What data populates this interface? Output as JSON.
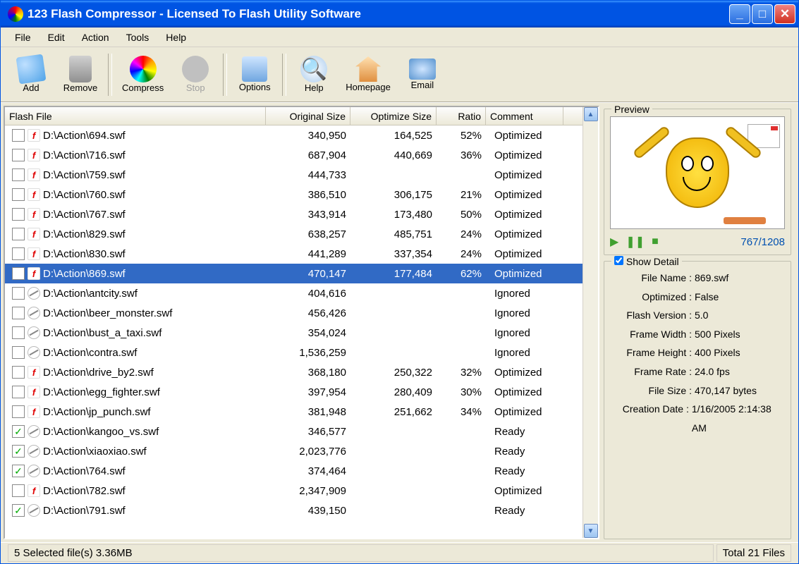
{
  "window": {
    "title": "123 Flash Compressor - Licensed To Flash Utility Software"
  },
  "menu": {
    "file": "File",
    "edit": "Edit",
    "action": "Action",
    "tools": "Tools",
    "help": "Help"
  },
  "toolbar": {
    "add": "Add",
    "remove": "Remove",
    "compress": "Compress",
    "stop": "Stop",
    "options": "Options",
    "help": "Help",
    "homepage": "Homepage",
    "email": "Email"
  },
  "columns": {
    "file": "Flash File",
    "orig": "Original Size",
    "opt": "Optimize Size",
    "ratio": "Ratio",
    "comment": "Comment"
  },
  "rows": [
    {
      "chk": false,
      "type": "flash",
      "path": "D:\\Action\\694.swf",
      "orig": "340,950",
      "opt": "164,525",
      "ratio": "52%",
      "comment": "Optimized",
      "sel": false
    },
    {
      "chk": false,
      "type": "flash",
      "path": "D:\\Action\\716.swf",
      "orig": "687,904",
      "opt": "440,669",
      "ratio": "36%",
      "comment": "Optimized",
      "sel": false
    },
    {
      "chk": false,
      "type": "flash",
      "path": "D:\\Action\\759.swf",
      "orig": "444,733",
      "opt": "",
      "ratio": "",
      "comment": "Optimized",
      "sel": false
    },
    {
      "chk": false,
      "type": "flash",
      "path": "D:\\Action\\760.swf",
      "orig": "386,510",
      "opt": "306,175",
      "ratio": "21%",
      "comment": "Optimized",
      "sel": false
    },
    {
      "chk": false,
      "type": "flash",
      "path": "D:\\Action\\767.swf",
      "orig": "343,914",
      "opt": "173,480",
      "ratio": "50%",
      "comment": "Optimized",
      "sel": false
    },
    {
      "chk": false,
      "type": "flash",
      "path": "D:\\Action\\829.swf",
      "orig": "638,257",
      "opt": "485,751",
      "ratio": "24%",
      "comment": "Optimized",
      "sel": false
    },
    {
      "chk": false,
      "type": "flash",
      "path": "D:\\Action\\830.swf",
      "orig": "441,289",
      "opt": "337,354",
      "ratio": "24%",
      "comment": "Optimized",
      "sel": false
    },
    {
      "chk": false,
      "type": "flash",
      "path": "D:\\Action\\869.swf",
      "orig": "470,147",
      "opt": "177,484",
      "ratio": "62%",
      "comment": "Optimized",
      "sel": true
    },
    {
      "chk": false,
      "type": "ignore",
      "path": "D:\\Action\\antcity.swf",
      "orig": "404,616",
      "opt": "",
      "ratio": "",
      "comment": "Ignored",
      "sel": false
    },
    {
      "chk": false,
      "type": "ignore",
      "path": "D:\\Action\\beer_monster.swf",
      "orig": "456,426",
      "opt": "",
      "ratio": "",
      "comment": "Ignored",
      "sel": false
    },
    {
      "chk": false,
      "type": "ignore",
      "path": "D:\\Action\\bust_a_taxi.swf",
      "orig": "354,024",
      "opt": "",
      "ratio": "",
      "comment": "Ignored",
      "sel": false
    },
    {
      "chk": false,
      "type": "ignore",
      "path": "D:\\Action\\contra.swf",
      "orig": "1,536,259",
      "opt": "",
      "ratio": "",
      "comment": "Ignored",
      "sel": false
    },
    {
      "chk": false,
      "type": "flash",
      "path": "D:\\Action\\drive_by2.swf",
      "orig": "368,180",
      "opt": "250,322",
      "ratio": "32%",
      "comment": "Optimized",
      "sel": false
    },
    {
      "chk": false,
      "type": "flash",
      "path": "D:\\Action\\egg_fighter.swf",
      "orig": "397,954",
      "opt": "280,409",
      "ratio": "30%",
      "comment": "Optimized",
      "sel": false
    },
    {
      "chk": false,
      "type": "flash",
      "path": "D:\\Action\\jp_punch.swf",
      "orig": "381,948",
      "opt": "251,662",
      "ratio": "34%",
      "comment": "Optimized",
      "sel": false
    },
    {
      "chk": true,
      "type": "ignore",
      "path": "D:\\Action\\kangoo_vs.swf",
      "orig": "346,577",
      "opt": "",
      "ratio": "",
      "comment": "Ready",
      "sel": false
    },
    {
      "chk": true,
      "type": "ignore",
      "path": "D:\\Action\\xiaoxiao.swf",
      "orig": "2,023,776",
      "opt": "",
      "ratio": "",
      "comment": "Ready",
      "sel": false
    },
    {
      "chk": true,
      "type": "ignore",
      "path": "D:\\Action\\764.swf",
      "orig": "374,464",
      "opt": "",
      "ratio": "",
      "comment": "Ready",
      "sel": false
    },
    {
      "chk": false,
      "type": "flash",
      "path": "D:\\Action\\782.swf",
      "orig": "2,347,909",
      "opt": "",
      "ratio": "",
      "comment": "Optimized",
      "sel": false
    },
    {
      "chk": true,
      "type": "ignore",
      "path": "D:\\Action\\791.swf",
      "orig": "439,150",
      "opt": "",
      "ratio": "",
      "comment": "Ready",
      "sel": false
    }
  ],
  "preview": {
    "title": "Preview",
    "frame_counter": "767/1208",
    "show_detail": "Show Detail",
    "labels": {
      "filename": "File Name :",
      "optimized": "Optimized :",
      "version": "Flash Version :",
      "width": "Frame Width :",
      "height": "Frame Height :",
      "rate": "Frame Rate :",
      "size": "File Size :",
      "date": "Creation Date :"
    },
    "values": {
      "filename": "869.swf",
      "optimized": "False",
      "version": "5.0",
      "width": "500 Pixels",
      "height": "400 Pixels",
      "rate": "24.0 fps",
      "size": "470,147 bytes",
      "date": "1/16/2005 2:14:38 AM"
    }
  },
  "status": {
    "left": "5 Selected file(s)  3.36MB",
    "right": "Total 21 Files"
  }
}
